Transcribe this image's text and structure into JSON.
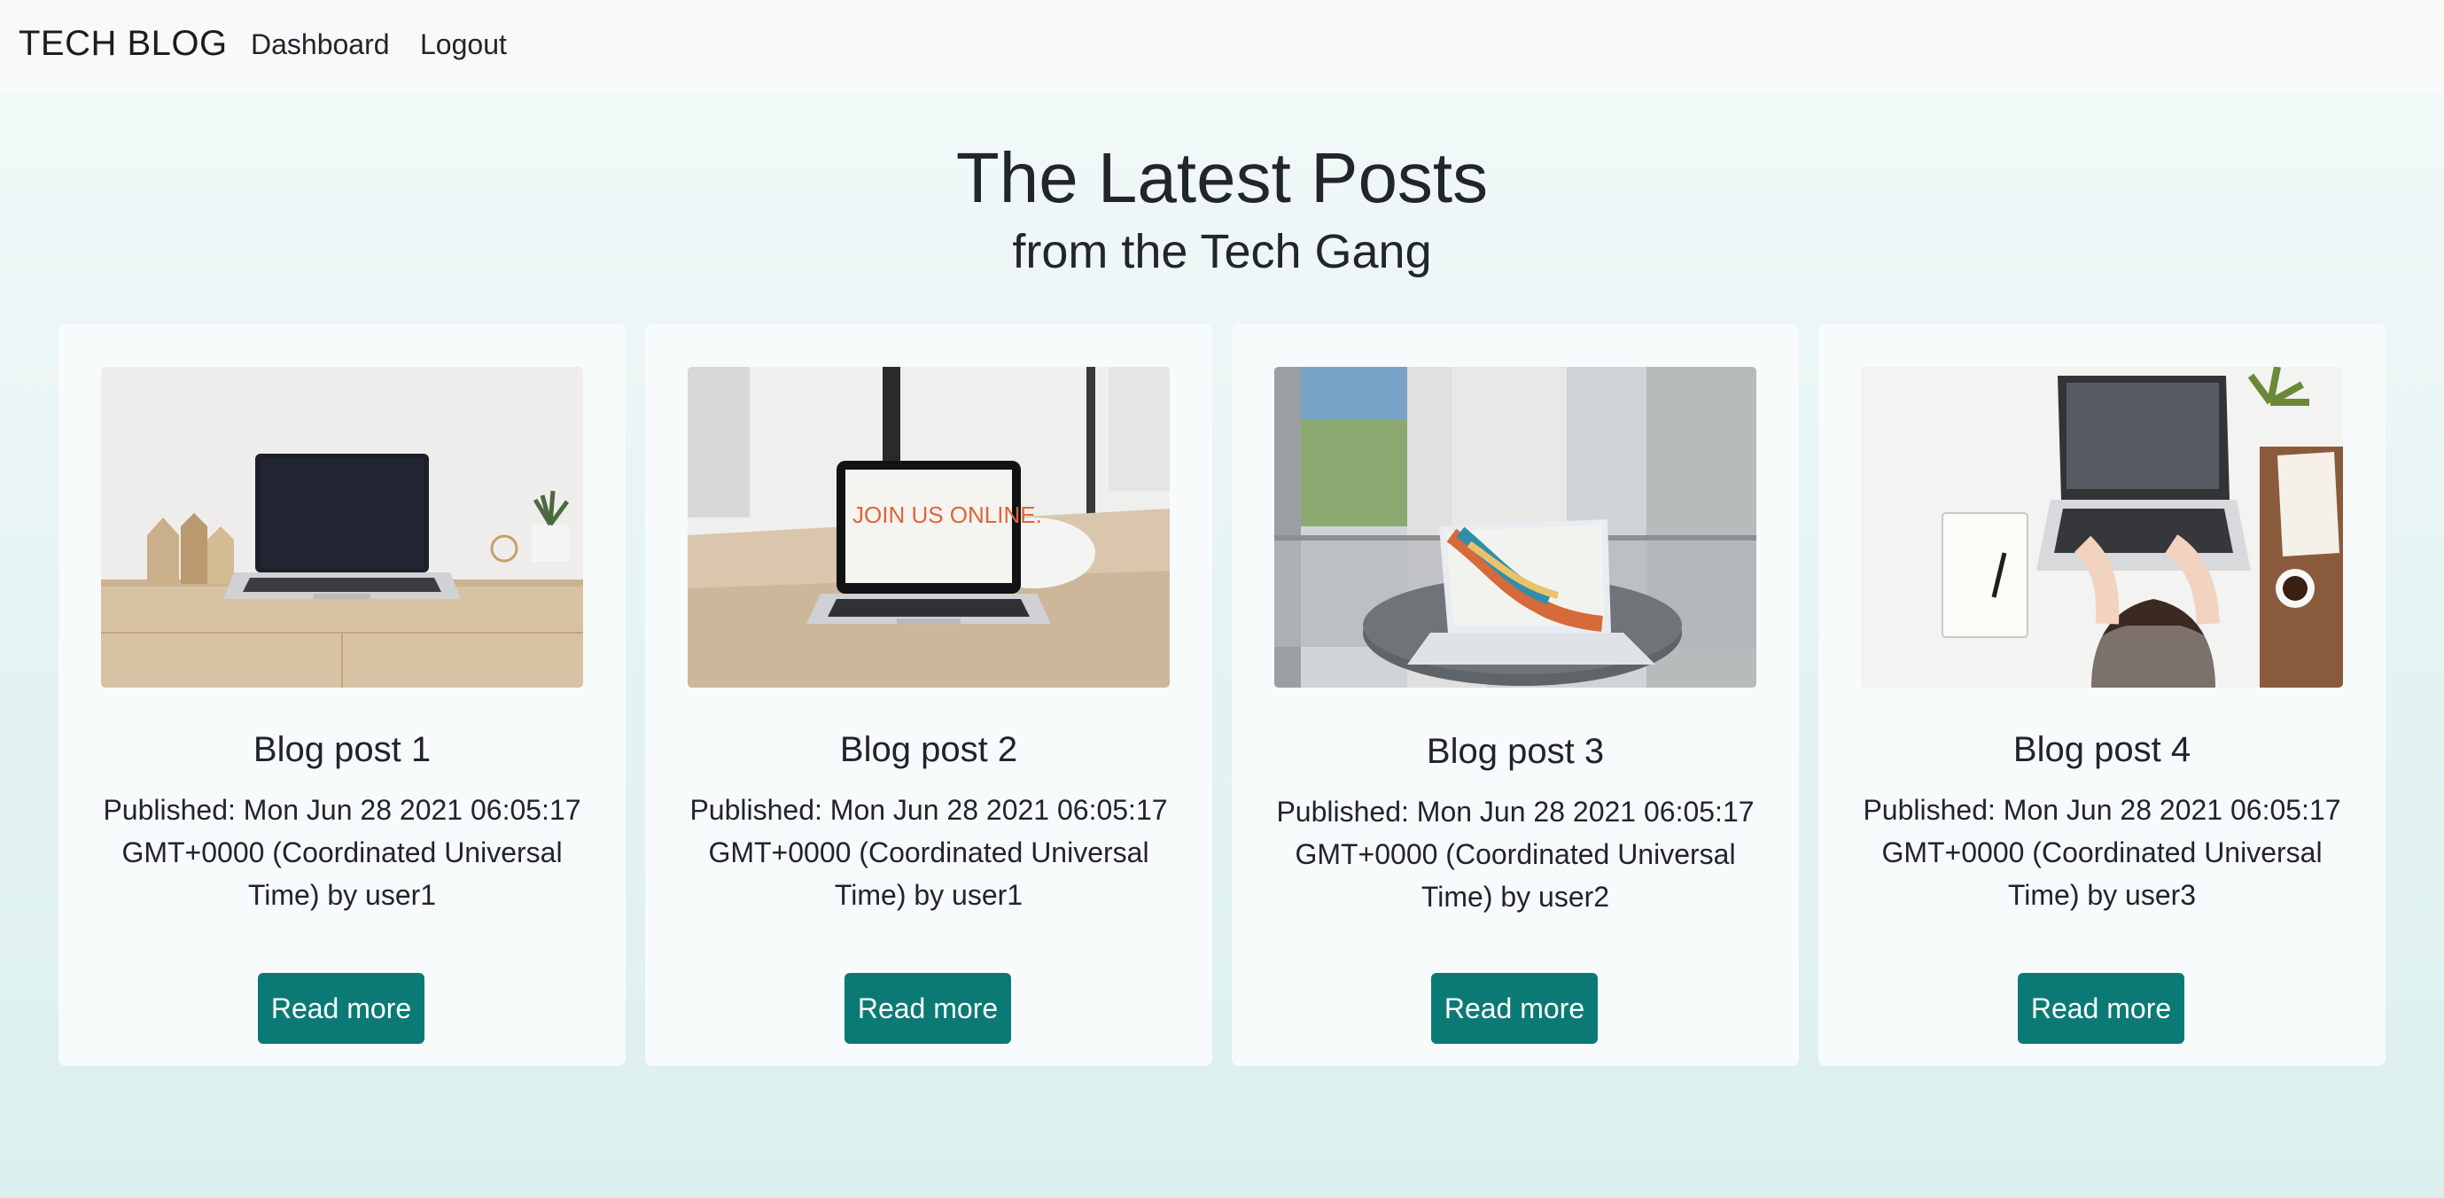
{
  "nav": {
    "brand": "TECH BLOG",
    "links": [
      "Dashboard",
      "Logout"
    ]
  },
  "hero": {
    "title": "The Latest Posts",
    "subtitle": "from the Tech Gang"
  },
  "posts": [
    {
      "title": "Blog post 1",
      "meta": "Published: Mon Jun 28 2021 06:05:17 GMT+0000 (Coordinated Universal Time) by user1",
      "button": "Read more"
    },
    {
      "title": "Blog post 2",
      "meta": "Published: Mon Jun 28 2021 06:05:17 GMT+0000 (Coordinated Universal Time) by user1",
      "button": "Read more",
      "screen_text": "JOIN US ONLINE."
    },
    {
      "title": "Blog post 3",
      "meta": "Published: Mon Jun 28 2021 06:05:17 GMT+0000 (Coordinated Universal Time) by user2",
      "button": "Read more"
    },
    {
      "title": "Blog post 4",
      "meta": "Published: Mon Jun 28 2021 06:05:17 GMT+0000 (Coordinated Universal Time) by user3",
      "button": "Read more"
    }
  ],
  "colors": {
    "accent": "#0b7a75",
    "background": "#e6f4f3",
    "card": "#f8fbfb"
  }
}
